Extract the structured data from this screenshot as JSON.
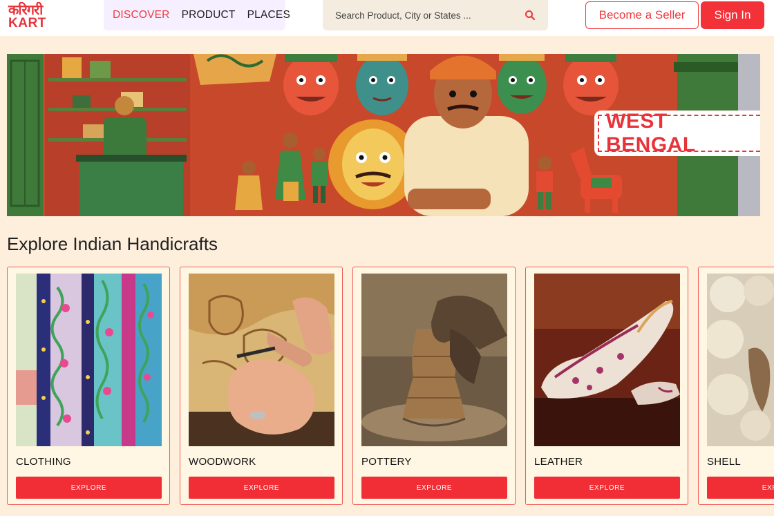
{
  "header": {
    "logo_hindi": "करिगरी",
    "logo_english": "KART",
    "nav": [
      {
        "label": "DISCOVER",
        "active": true
      },
      {
        "label": "PRODUCT",
        "active": false
      },
      {
        "label": "PLACES",
        "active": false
      }
    ],
    "search": {
      "placeholder": "Search Product, City or States ...",
      "icon": "search-icon"
    },
    "become_seller": "Become a Seller",
    "sign_in": "Sign In"
  },
  "banner": {
    "label": "WEST BENGAL"
  },
  "section": {
    "title": "Explore Indian Handicrafts"
  },
  "cards": [
    {
      "name": "CLOTHING",
      "button": "EXPLORE"
    },
    {
      "name": "WOODWORK",
      "button": "EXPLORE"
    },
    {
      "name": "POTTERY",
      "button": "EXPLORE"
    },
    {
      "name": "LEATHER",
      "button": "EXPLORE"
    },
    {
      "name": "SHELL",
      "button": "EXPLORE"
    }
  ],
  "colors": {
    "accent": "#f12e35",
    "background": "#fdefdc",
    "card_bg": "#fff7e3"
  }
}
